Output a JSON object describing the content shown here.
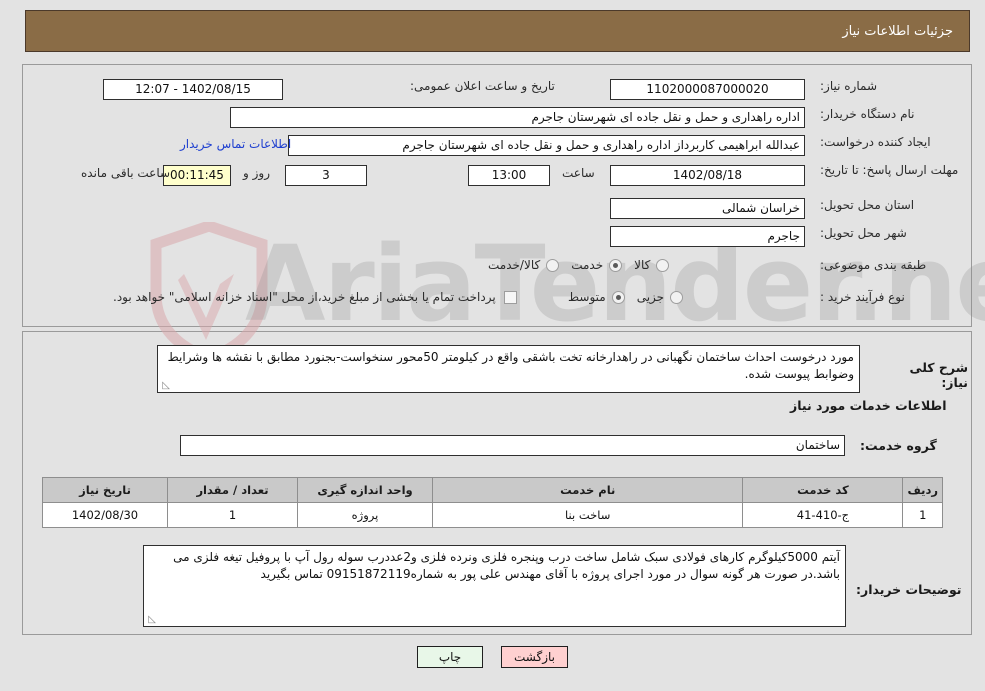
{
  "header": {
    "title": "جزئیات اطلاعات نیاز"
  },
  "watermark": {
    "text": "AriaTender.net",
    "shield_color": "#d9a8ab",
    "text_color": "#8c8c8c"
  },
  "form": {
    "need_number_label": "شماره نیاز:",
    "need_number_value": "1102000087000020",
    "announce_datetime_label": "تاریخ و ساعت اعلان عمومی:",
    "announce_datetime_value": "1402/08/15 - 12:07",
    "buyer_org_label": "نام دستگاه خریدار:",
    "buyer_org_value": "اداره راهداری و حمل و نقل جاده ای شهرستان جاجرم",
    "requester_label": "ایجاد کننده درخواست:",
    "requester_value": "عبدالله ابراهیمی کاربرداز اداره راهداری و حمل و نقل جاده ای شهرستان جاجرم",
    "buyer_contact_link": "اطلاعات تماس خریدار",
    "deadline_label": "مهلت ارسال پاسخ: تا تاریخ:",
    "deadline_date": "1402/08/18",
    "deadline_hour_label": "ساعت",
    "deadline_hour": "13:00",
    "remaining_days": "3",
    "days_and_label": "روز و",
    "remaining_time": "00:11:45",
    "remaining_suffix": "ساعت باقی مانده",
    "province_label": "استان محل تحویل:",
    "province_value": "خراسان شمالی",
    "city_label": "شهر محل تحویل:",
    "city_value": "جاجرم",
    "category_label": "طبقه بندی موضوعی:",
    "category_options": [
      {
        "label": "کالا",
        "selected": false
      },
      {
        "label": "خدمت",
        "selected": true
      },
      {
        "label": "کالا/خدمت",
        "selected": false
      }
    ],
    "process_label": "نوع فرآیند خرید :",
    "process_options": [
      {
        "label": "جزیی",
        "selected": false
      },
      {
        "label": "متوسط",
        "selected": true
      }
    ],
    "treasury_checkbox_label": "پرداخت تمام یا بخشی از مبلغ خرید،از محل \"اسناد خزانه اسلامی\" خواهد بود.",
    "treasury_checked": false,
    "need_description_label": "شرح کلی نیاز:",
    "need_description_value": "مورد درخوست احداث ساختمان نگهبانی در راهدارخانه تخت باشقی واقع در کیلومتر 50محور سنخواست-بجنورد مطابق با نقشه ها وشرایط وضوابط پیوست شده."
  },
  "services_section": {
    "heading": "اطلاعات خدمات مورد نیاز",
    "service_group_label": "گروه خدمت:",
    "service_group_value": "ساختمان",
    "table": {
      "columns": [
        "ردیف",
        "کد خدمت",
        "نام خدمت",
        "واحد اندازه گیری",
        "تعداد / مقدار",
        "تاریخ نیاز"
      ],
      "rows": [
        {
          "row_no": "1",
          "service_code": "ج-410-41",
          "service_name": "ساخت بنا",
          "unit": "پروژه",
          "quantity": "1",
          "need_date": "1402/08/30"
        }
      ]
    }
  },
  "buyer_notes": {
    "label": "توضیحات خریدار:",
    "value": "آیتم 5000کیلوگرم کارهای فولادی سبک شامل ساخت درب وپنجره فلزی ونرده فلزی و2عددرب سوله رول آپ با پروفیل تیغه فلزی می باشد.در صورت هر گونه سوال در مورد اجرای پروژه با آقای مهندس علی پور به شماره09151872119 تماس بگیرید"
  },
  "footer": {
    "back_button": "بازگشت",
    "print_button": "چاپ"
  }
}
